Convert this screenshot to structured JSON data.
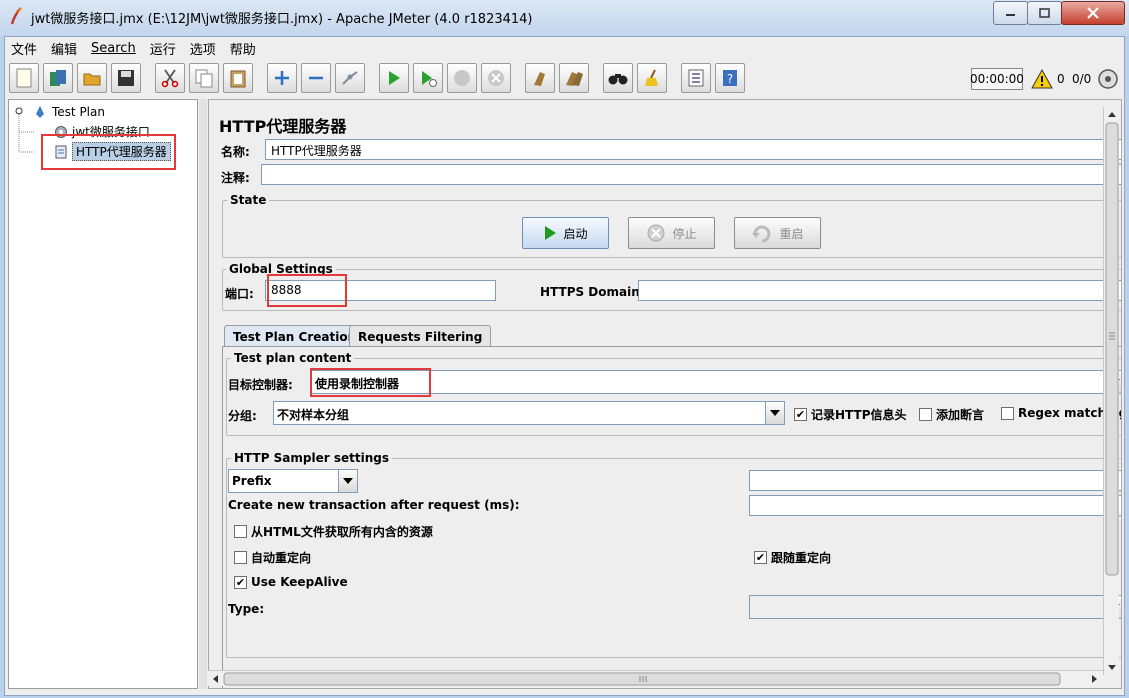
{
  "window": {
    "title": "jwt微服务接口.jmx (E:\\12JM\\jwt微服务接口.jmx) - Apache JMeter (4.0 r1823414)"
  },
  "menu": {
    "items": [
      "文件",
      "编辑",
      "Search",
      "运行",
      "选项",
      "帮助"
    ]
  },
  "toolbar": {
    "timer": "00:00:00",
    "error_count": "0",
    "thread_count": "0/0"
  },
  "tree": {
    "root": "Test Plan",
    "children": [
      "jwt微服务接口",
      "HTTP代理服务器"
    ]
  },
  "panel": {
    "title": "HTTP代理服务器",
    "name_label": "名称:",
    "name_value": "HTTP代理服务器",
    "comment_label": "注释:",
    "comment_value": "",
    "state": {
      "title": "State",
      "start": "启动",
      "stop": "停止",
      "restart": "重启"
    },
    "global": {
      "title": "Global Settings",
      "port_label": "端口:",
      "port_value": "8888",
      "https_label": "HTTPS Domains:",
      "https_value": ""
    },
    "tabs": [
      "Test Plan Creation",
      "Requests Filtering"
    ],
    "content": {
      "title": "Test plan content",
      "target_label": "目标控制器:",
      "target_value": "使用录制控制器",
      "group_label": "分组:",
      "group_value": "不对样本分组",
      "record_headers": "记录HTTP信息头",
      "add_assertions": "添加断言",
      "regex_matching": "Regex matching"
    },
    "sampler": {
      "title": "HTTP Sampler settings",
      "prefix_value": "Prefix",
      "prefix_input": "",
      "transaction_label": "Create new transaction after request (ms):",
      "transaction_value": "",
      "retrieve_resources": "从HTML文件获取所有内含的资源",
      "auto_redirect": "自动重定向",
      "follow_redirects": "跟随重定向",
      "keepalive": "Use KeepAlive",
      "type_label": "Type:",
      "type_value": ""
    }
  },
  "colors": {
    "highlight": "#e23a3a",
    "selection": "#b8cfe5"
  }
}
